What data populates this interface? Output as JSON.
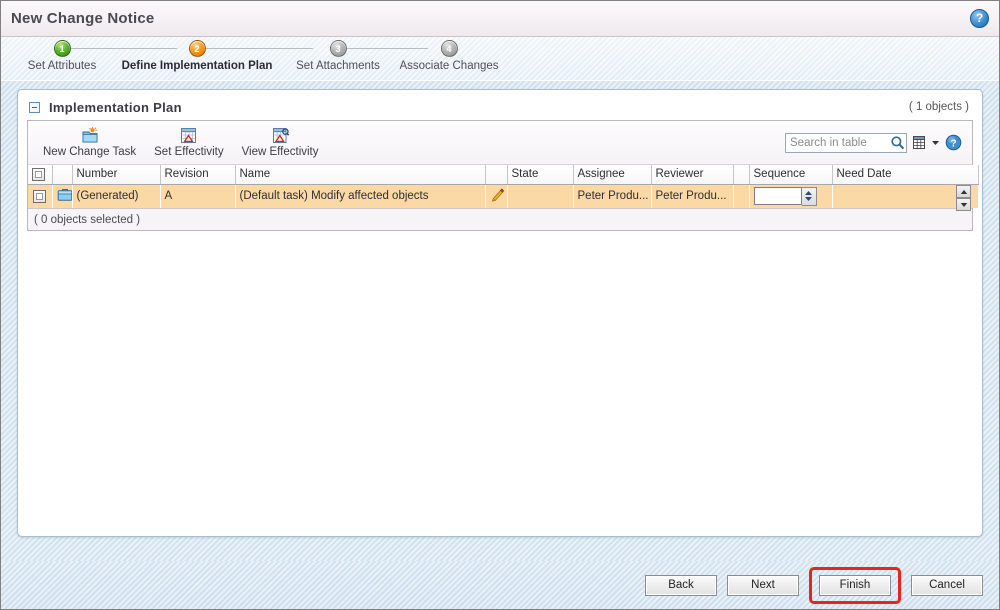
{
  "window": {
    "title": "New Change Notice",
    "help_icon": "help-circle-icon",
    "help_label": "?"
  },
  "wizard": {
    "steps": [
      {
        "number": "1",
        "label": "Set Attributes",
        "state": "done"
      },
      {
        "number": "2",
        "label": "Define Implementation Plan",
        "state": "current"
      },
      {
        "number": "3",
        "label": "Set Attachments",
        "state": "todo"
      },
      {
        "number": "4",
        "label": "Associate Changes",
        "state": "todo"
      }
    ]
  },
  "panel": {
    "collapse_icon": "collapse-minus-icon",
    "title": "Implementation Plan",
    "object_count": "( 1 objects )"
  },
  "toolbar": {
    "buttons": [
      {
        "label": "New Change Task",
        "icon": "new-folder-icon"
      },
      {
        "label": "Set Effectivity",
        "icon": "calendar-set-icon"
      },
      {
        "label": "View Effectivity",
        "icon": "calendar-view-icon"
      }
    ],
    "search": {
      "placeholder": "Search in table",
      "value": "",
      "search_icon": "magnifier-icon",
      "table_options_icon": "table-grid-icon",
      "dropdown_icon": "chevron-down-icon",
      "help_icon": "help-circle-icon"
    }
  },
  "table": {
    "columns": [
      "",
      "",
      "Number",
      "Revision",
      "Name",
      "",
      "State",
      "Assignee",
      "Reviewer",
      "",
      "Sequence",
      "Need Date"
    ],
    "rows": [
      {
        "selected_highlight": true,
        "checkbox": false,
        "type_icon": "briefcase-icon",
        "number": "(Generated)",
        "revision": "A",
        "name": "(Default task) Modify affected objects",
        "edit_icon": "pencil-icon",
        "state": "",
        "assignee": "Peter Produ...",
        "reviewer": "Peter Produ...",
        "sequence": "",
        "need_date": ""
      }
    ],
    "scroll_up_icon": "scroll-up-icon",
    "scroll_down_icon": "scroll-down-icon",
    "status": "( 0 objects selected )"
  },
  "footer": {
    "buttons": [
      {
        "label": "Back",
        "highlighted": false
      },
      {
        "label": "Next",
        "highlighted": false
      },
      {
        "label": "Finish",
        "highlighted": true
      },
      {
        "label": "Cancel",
        "highlighted": false
      }
    ]
  },
  "colors": {
    "highlight_annotation": "#e8241b",
    "row_selected": "#fbd9a5",
    "step_done": "#5cb531",
    "step_current": "#f79a1e",
    "step_todo": "#b4b4b4",
    "body_background": "#d3e2ef"
  }
}
